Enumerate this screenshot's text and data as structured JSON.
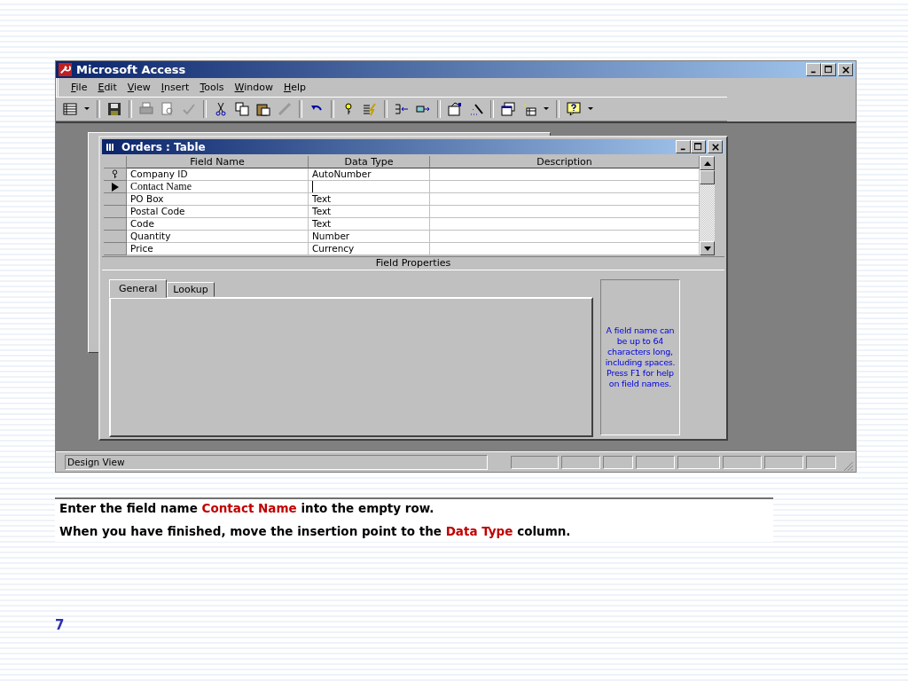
{
  "window": {
    "title": "Microsoft Access"
  },
  "menu": [
    "File",
    "Edit",
    "View",
    "Insert",
    "Tools",
    "Window",
    "Help"
  ],
  "child_window": {
    "title": "Orders : Table"
  },
  "columns": [
    "Field Name",
    "Data Type",
    "Description"
  ],
  "rows": [
    {
      "field_name": "Company ID",
      "data_type": "AutoNumber",
      "kind": "key"
    },
    {
      "field_name": "Contact Name",
      "data_type": "",
      "kind": "current"
    },
    {
      "field_name": "PO Box",
      "data_type": "Text",
      "kind": "plain"
    },
    {
      "field_name": "Postal Code",
      "data_type": "Text",
      "kind": "plain"
    },
    {
      "field_name": "Code",
      "data_type": "Text",
      "kind": "plain"
    },
    {
      "field_name": "Quantity",
      "data_type": "Number",
      "kind": "plain"
    },
    {
      "field_name": "Price",
      "data_type": "Currency",
      "kind": "plain"
    }
  ],
  "field_properties": {
    "title": "Field Properties",
    "tabs": [
      {
        "label": "General",
        "selected": true
      },
      {
        "label": "Lookup",
        "selected": false
      }
    ],
    "help_text": "A field name can be up to 64 characters long, including spaces.  Press F1 for help on field names."
  },
  "status_bar": {
    "text": "Design View"
  },
  "instructions": [
    {
      "parts": [
        {
          "text": "Enter the field name ",
          "highlight": false
        },
        {
          "text": "Contact Name",
          "highlight": true
        },
        {
          "text": " into the empty row.",
          "highlight": false
        }
      ]
    },
    {
      "parts": [
        {
          "text": "When you have finished, move the insertion point to the ",
          "highlight": false
        },
        {
          "text": "Data Type",
          "highlight": true
        },
        {
          "text": " column.",
          "highlight": false
        }
      ]
    }
  ],
  "page_number": "7"
}
